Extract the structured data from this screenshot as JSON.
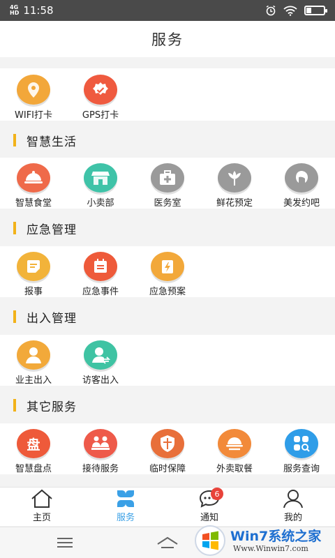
{
  "status_bar": {
    "network": "4G",
    "network_sub": "HD",
    "time": "11:58"
  },
  "header": {
    "title": "服务"
  },
  "quick": {
    "items": [
      {
        "label": "WIFI打卡",
        "icon": "location-pin-icon",
        "color": "#f2a73a"
      },
      {
        "label": "GPS打卡",
        "icon": "check-badge-icon",
        "color": "#ef5a3f"
      }
    ]
  },
  "sections": [
    {
      "title": "智慧生活",
      "items": [
        {
          "label": "智慧食堂",
          "icon": "cloche-icon",
          "color": "#ef6a4a"
        },
        {
          "label": "小卖部",
          "icon": "store-icon",
          "color": "#3fc3a8"
        },
        {
          "label": "医务室",
          "icon": "medical-kit-icon",
          "color": "#9a9a9a"
        },
        {
          "label": "鲜花预定",
          "icon": "flower-icon",
          "color": "#9a9a9a"
        },
        {
          "label": "美发约吧",
          "icon": "hair-salon-icon",
          "color": "#9a9a9a"
        }
      ]
    },
    {
      "title": "应急管理",
      "items": [
        {
          "label": "报事",
          "icon": "report-icon",
          "color": "#f2b33a"
        },
        {
          "label": "应急事件",
          "icon": "calendar-alert-icon",
          "color": "#ee5a3a"
        },
        {
          "label": "应急预案",
          "icon": "lightning-doc-icon",
          "color": "#f2a83a"
        }
      ]
    },
    {
      "title": "出入管理",
      "items": [
        {
          "label": "业主出入",
          "icon": "owner-user-icon",
          "color": "#f2a93a"
        },
        {
          "label": "访客出入",
          "icon": "visitor-user-icon",
          "color": "#3fc3a3"
        }
      ]
    },
    {
      "title": "其它服务",
      "items": [
        {
          "label": "智慧盘点",
          "icon": "inventory-icon",
          "color": "#ee5a3a",
          "glyph": "盘"
        },
        {
          "label": "接待服务",
          "icon": "reception-icon",
          "color": "#ee5a4a"
        },
        {
          "label": "临时保障",
          "icon": "shield-icon",
          "color": "#e86f3a"
        },
        {
          "label": "外卖取餐",
          "icon": "takeout-icon",
          "color": "#f28a3a"
        },
        {
          "label": "服务查询",
          "icon": "search-grid-icon",
          "color": "#2f9de8"
        }
      ]
    }
  ],
  "tabs": [
    {
      "label": "主页",
      "icon": "home-icon"
    },
    {
      "label": "服务",
      "icon": "services-grid-icon",
      "active": true
    },
    {
      "label": "通知",
      "icon": "message-icon",
      "badge": "6"
    },
    {
      "label": "我的",
      "icon": "profile-icon"
    }
  ],
  "watermark": {
    "logo": "Win7系统之家",
    "url": "Www.Winwin7.com"
  },
  "accent": "#3aa0e6",
  "section_bar_color": "#f2b21a"
}
